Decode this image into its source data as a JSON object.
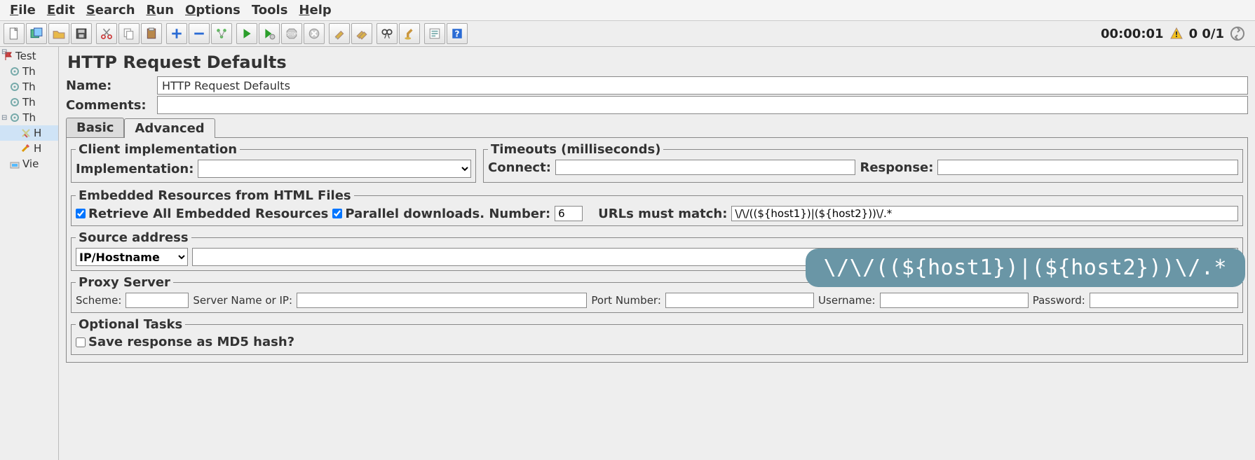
{
  "menu": {
    "file": "File",
    "edit": "Edit",
    "search": "Search",
    "run": "Run",
    "options": "Options",
    "tools": "Tools",
    "help": "Help"
  },
  "status": {
    "time": "00:00:01",
    "count": "0 0/1"
  },
  "tree": {
    "root": "Test",
    "items": [
      "Th",
      "Th",
      "Th",
      "Th"
    ],
    "selected": "H",
    "after": [
      "H",
      "Vie"
    ]
  },
  "editor": {
    "title": "HTTP Request Defaults",
    "name_label": "Name:",
    "name_value": "HTTP Request Defaults",
    "comments_label": "Comments:",
    "comments_value": ""
  },
  "tabs": {
    "basic": "Basic",
    "advanced": "Advanced"
  },
  "client": {
    "legend": "Client implementation",
    "impl_label": "Implementation:",
    "impl_value": ""
  },
  "timeouts": {
    "legend": "Timeouts (milliseconds)",
    "connect_label": "Connect:",
    "connect_value": "",
    "response_label": "Response:",
    "response_value": ""
  },
  "embedded": {
    "legend": "Embedded Resources from HTML Files",
    "retrieve_label": "Retrieve All Embedded Resources",
    "retrieve_checked": true,
    "parallel_label": "Parallel downloads. Number:",
    "parallel_checked": true,
    "parallel_value": "6",
    "match_label": "URLs must match:",
    "match_value": "\\/\\/((${host1})|(${host2}))\\/.*"
  },
  "source": {
    "legend": "Source address",
    "type": "IP/Hostname",
    "address": ""
  },
  "proxy": {
    "legend": "Proxy Server",
    "scheme_label": "Scheme:",
    "scheme": "",
    "server_label": "Server Name or IP:",
    "server": "",
    "port_label": "Port Number:",
    "port": "",
    "user_label": "Username:",
    "user": "",
    "pass_label": "Password:",
    "pass": ""
  },
  "optional": {
    "legend": "Optional Tasks",
    "md5_label": "Save response as MD5 hash?",
    "md5_checked": false
  },
  "bubble": "\\/\\/((${host1})|(${host2}))\\/.*"
}
